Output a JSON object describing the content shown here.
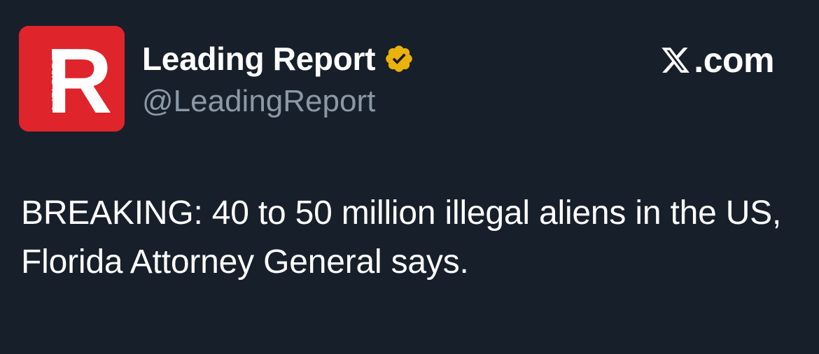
{
  "account": {
    "display_name": "Leading Report",
    "handle": "@LeadingReport",
    "verified": true,
    "avatar": {
      "letter": "R",
      "vertical_text": "LEADING",
      "background_color": "#e0242b"
    },
    "badge_color": "#e9b20c"
  },
  "brand": {
    "icon": "x-logo-icon",
    "text": ".com"
  },
  "tweet": {
    "text": "BREAKING: 40 to 50 million illegal aliens in the US, Florida Attorney General says."
  },
  "colors": {
    "background": "#17202a",
    "primary_text": "#ffffff",
    "secondary_text": "#8b98a5"
  }
}
